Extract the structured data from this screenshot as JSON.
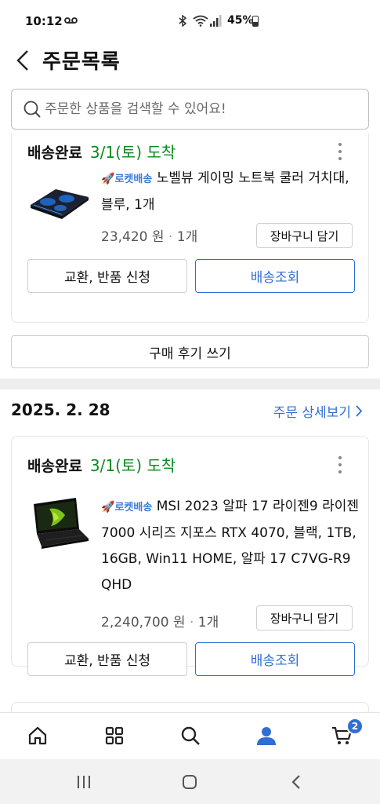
{
  "status_bar": {
    "time": "10:12",
    "battery": "45%",
    "icons": [
      "voicemail-icon",
      "bluetooth-icon",
      "wifi-icon",
      "signal-icon",
      "battery-icon"
    ]
  },
  "header": {
    "title": "주문목록",
    "back_icon": "chevron-left-icon"
  },
  "search": {
    "placeholder": "주문한 상품을 검색할 수 있어요!",
    "icon": "search-icon"
  },
  "orders": [
    {
      "status": "배송완료",
      "arrival": "3/1(토) 도착",
      "rocket_label": "로켓배송",
      "product_name": "노벨뷰 게이밍 노트북 쿨러 거치대, 블루, 1개",
      "price": "23,420 원",
      "quantity": "1개",
      "cart_label": "장바구니 담기",
      "exchange_label": "교환, 반품 신청",
      "track_label": "배송조회",
      "review_label": "구매 후기 쓰기"
    },
    {
      "date": "2025. 2. 28",
      "detail_link": "주문 상세보기",
      "status": "배송완료",
      "arrival": "3/1(토) 도착",
      "rocket_label": "로켓배송",
      "product_name": "MSI 2023 알파 17 라이젠9 라이젠 7000 시리즈 지포스 RTX 4070, 블랙, 1TB, 16GB, Win11 HOME, 알파 17 C7VG-R9 QHD",
      "price": "2,240,700 원",
      "quantity": "1개",
      "cart_label": "장바구니 담기",
      "exchange_label": "교환, 반품 신청",
      "track_label": "배송조회"
    }
  ],
  "bottom_nav": {
    "items": [
      "home-icon",
      "categories-icon",
      "search-icon",
      "account-icon",
      "cart-icon"
    ],
    "cart_badge": "2",
    "active": "account-icon"
  },
  "system_nav": [
    "recent-apps-icon",
    "home-button-icon",
    "back-icon"
  ],
  "colors": {
    "accent_blue": "#2f6ed3",
    "delivered_green": "#0a8a1f",
    "rocket_blue": "#3a7ad9"
  }
}
